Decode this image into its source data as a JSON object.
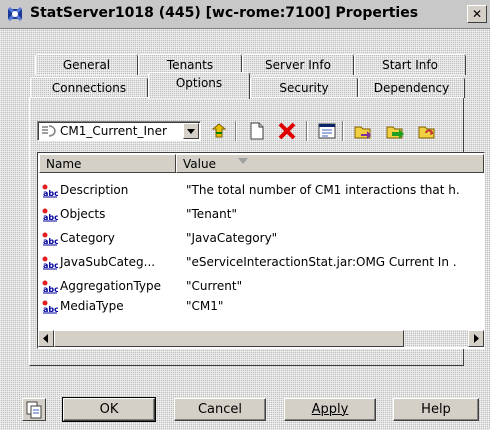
{
  "window": {
    "title": "StatServer1018 (445) [wc-rome:7100] Properties",
    "close_label": "✕"
  },
  "tabs": {
    "back_row": [
      "General",
      "Tenants",
      "Server Info",
      "Start Info"
    ],
    "front_row": [
      "Connections",
      "Options",
      "Security",
      "Dependency"
    ],
    "active": "Options"
  },
  "toolbar": {
    "section_select": "CM1_Current_Iner",
    "icons": [
      "up-folder-icon",
      "new-document-icon",
      "delete-icon",
      "properties-icon",
      "export-icon",
      "import-icon",
      "refresh-icon"
    ]
  },
  "list": {
    "columns": [
      "Name",
      "Value"
    ],
    "rows": [
      {
        "name": "Description",
        "value": "\"The total number of CM1 interactions that h."
      },
      {
        "name": "Objects",
        "value": "\"Tenant\""
      },
      {
        "name": "Category",
        "value": "\"JavaCategory\""
      },
      {
        "name": "JavaSubCateg...",
        "value": "\"eServiceInteractionStat.jar:OMG Current In ."
      },
      {
        "name": "AggregationType",
        "value": "\"Current\""
      },
      {
        "name": "MediaType",
        "value": "\"CM1\""
      }
    ]
  },
  "buttons": {
    "ok": "OK",
    "cancel": "Cancel",
    "apply": "Apply",
    "help": "Help"
  },
  "colors": {
    "dialog": "#d4d0c8",
    "delete_icon": "#e00000",
    "list_background": "#ffffff"
  }
}
